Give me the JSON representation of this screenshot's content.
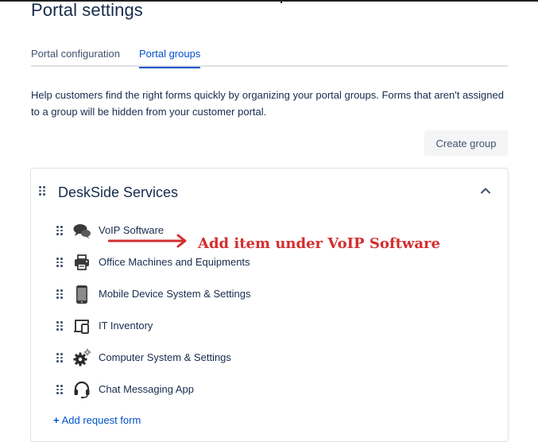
{
  "page": {
    "title": "Portal settings",
    "help_text": "Help customers find the right forms quickly by organizing your portal groups. Forms that aren't assigned to a group will be hidden from your customer portal."
  },
  "tabs": [
    {
      "label": "Portal configuration",
      "active": false
    },
    {
      "label": "Portal groups",
      "active": true
    }
  ],
  "actions": {
    "create_group_label": "Create group"
  },
  "group": {
    "title": "DeskSide Services",
    "expanded": true,
    "items": [
      {
        "label": "VoIP Software",
        "icon": "chat-bubbles-icon"
      },
      {
        "label": "Office Machines and Equipments",
        "icon": "printer-icon"
      },
      {
        "label": "Mobile Device System & Settings",
        "icon": "mobile-phone-icon"
      },
      {
        "label": "IT Inventory",
        "icon": "devices-icon"
      },
      {
        "label": "Computer System & Settings",
        "icon": "gears-icon"
      },
      {
        "label": "Chat Messaging App",
        "icon": "headset-icon"
      }
    ],
    "add_request_form_label": "Add request form"
  },
  "annotation": {
    "text": "Add item under VoIP Software",
    "color": "#d32f2f"
  },
  "colors": {
    "accent": "#0052cc",
    "text": "#172b4d",
    "subtle_text": "#42526e",
    "border": "#dfe1e6"
  }
}
